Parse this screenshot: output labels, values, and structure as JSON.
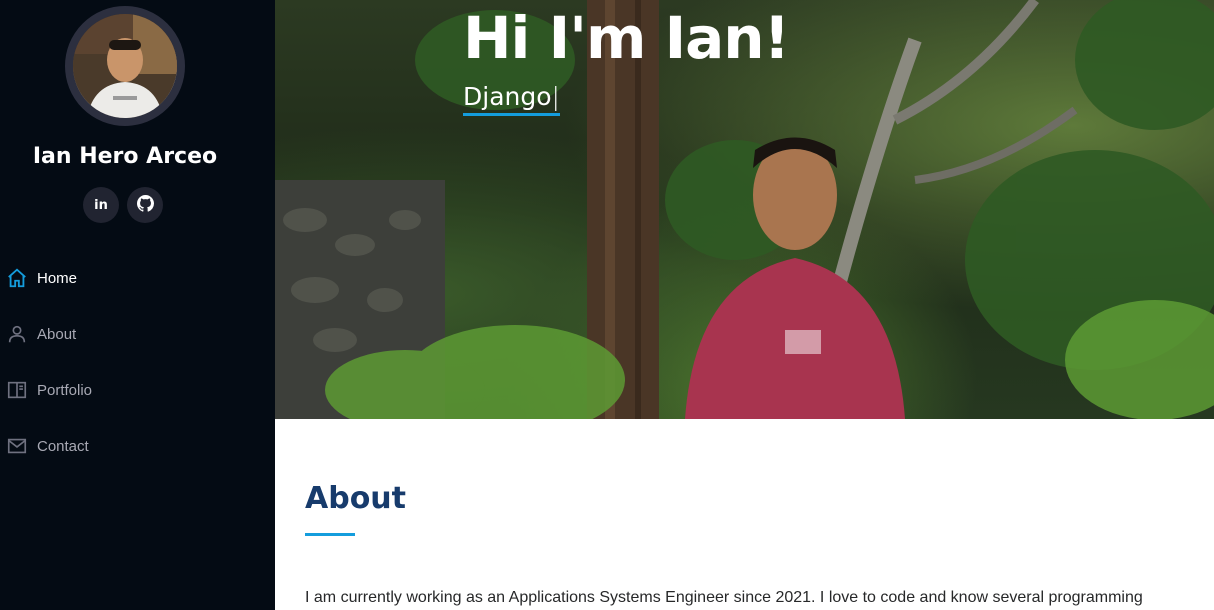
{
  "sidebar": {
    "profile_name": "Ian Hero Arceo",
    "social": [
      {
        "label": "in",
        "icon": "linkedin-icon"
      },
      {
        "label": "",
        "icon": "github-icon"
      }
    ],
    "nav": [
      {
        "label": "Home",
        "icon": "home-icon",
        "active": true
      },
      {
        "label": "About",
        "icon": "person-icon",
        "active": false
      },
      {
        "label": "Portfolio",
        "icon": "book-icon",
        "active": false
      },
      {
        "label": "Contact",
        "icon": "envelope-icon",
        "active": false
      }
    ]
  },
  "hero": {
    "title": "Hi I'm Ian!",
    "typed_text": "Django",
    "cursor": "|"
  },
  "about": {
    "title": "About",
    "text": "I am currently working as an Applications Systems Engineer since 2021. I love to code and know several programming"
  },
  "colors": {
    "sidebar_bg": "#040b14",
    "accent": "#149ddd",
    "heading": "#173b6c",
    "nav_inactive": "#a8a9b4"
  }
}
